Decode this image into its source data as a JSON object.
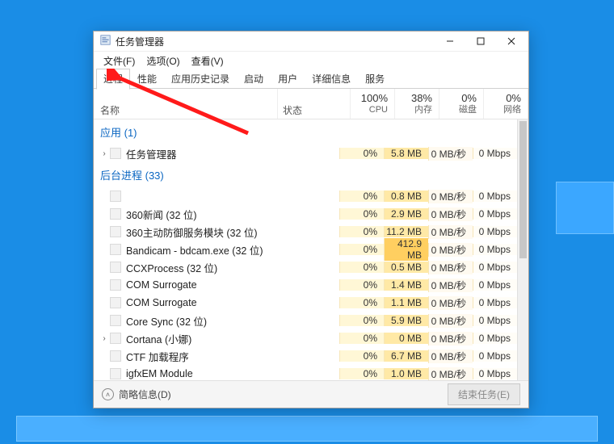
{
  "window": {
    "title": "任务管理器",
    "menus": [
      "文件(F)",
      "选项(O)",
      "查看(V)"
    ],
    "tabs": [
      "进程",
      "性能",
      "应用历史记录",
      "启动",
      "用户",
      "详细信息",
      "服务"
    ],
    "active_tab_index": 0
  },
  "columns": {
    "name": "名称",
    "status": "状态",
    "cpu": {
      "value": "100%",
      "label": "CPU"
    },
    "memory": {
      "value": "38%",
      "label": "内存"
    },
    "disk": {
      "value": "0%",
      "label": "磁盘"
    },
    "network": {
      "value": "0%",
      "label": "网络"
    }
  },
  "groups": {
    "apps": {
      "title": "应用 (1)"
    },
    "bg": {
      "title": "后台进程 (33)"
    }
  },
  "rows": [
    {
      "group": "apps",
      "expander": "›",
      "name": "任务管理器",
      "cpu": "0%",
      "mem": "5.8 MB",
      "disk": "0 MB/秒",
      "net": "0 Mbps",
      "mem_hi": false
    },
    {
      "group": "bg",
      "expander": "",
      "name": "",
      "cpu": "0%",
      "mem": "0.8 MB",
      "disk": "0 MB/秒",
      "net": "0 Mbps",
      "mem_hi": false
    },
    {
      "group": "bg",
      "expander": "",
      "name": "360新闻 (32 位)",
      "cpu": "0%",
      "mem": "2.9 MB",
      "disk": "0 MB/秒",
      "net": "0 Mbps",
      "mem_hi": false
    },
    {
      "group": "bg",
      "expander": "",
      "name": "360主动防御服务模块 (32 位)",
      "cpu": "0%",
      "mem": "11.2 MB",
      "disk": "0 MB/秒",
      "net": "0 Mbps",
      "mem_hi": false
    },
    {
      "group": "bg",
      "expander": "",
      "name": "Bandicam - bdcam.exe (32 位)",
      "cpu": "0%",
      "mem": "412.9 MB",
      "disk": "0 MB/秒",
      "net": "0 Mbps",
      "mem_hi": true
    },
    {
      "group": "bg",
      "expander": "",
      "name": "CCXProcess (32 位)",
      "cpu": "0%",
      "mem": "0.5 MB",
      "disk": "0 MB/秒",
      "net": "0 Mbps",
      "mem_hi": false
    },
    {
      "group": "bg",
      "expander": "",
      "name": "COM Surrogate",
      "cpu": "0%",
      "mem": "1.4 MB",
      "disk": "0 MB/秒",
      "net": "0 Mbps",
      "mem_hi": false
    },
    {
      "group": "bg",
      "expander": "",
      "name": "COM Surrogate",
      "cpu": "0%",
      "mem": "1.1 MB",
      "disk": "0 MB/秒",
      "net": "0 Mbps",
      "mem_hi": false
    },
    {
      "group": "bg",
      "expander": "",
      "name": "Core Sync (32 位)",
      "cpu": "0%",
      "mem": "5.9 MB",
      "disk": "0 MB/秒",
      "net": "0 Mbps",
      "mem_hi": false
    },
    {
      "group": "bg",
      "expander": "›",
      "name": "Cortana (小娜)",
      "cpu": "0%",
      "mem": "0 MB",
      "disk": "0 MB/秒",
      "net": "0 Mbps",
      "mem_hi": false
    },
    {
      "group": "bg",
      "expander": "",
      "name": "CTF 加载程序",
      "cpu": "0%",
      "mem": "6.7 MB",
      "disk": "0 MB/秒",
      "net": "0 Mbps",
      "mem_hi": false
    },
    {
      "group": "bg",
      "expander": "",
      "name": "igfxEM Module",
      "cpu": "0%",
      "mem": "1.0 MB",
      "disk": "0 MB/秒",
      "net": "0 Mbps",
      "mem_hi": false
    }
  ],
  "footer": {
    "fewer_details": "简略信息(D)",
    "end_task": "结束任务(E)"
  }
}
